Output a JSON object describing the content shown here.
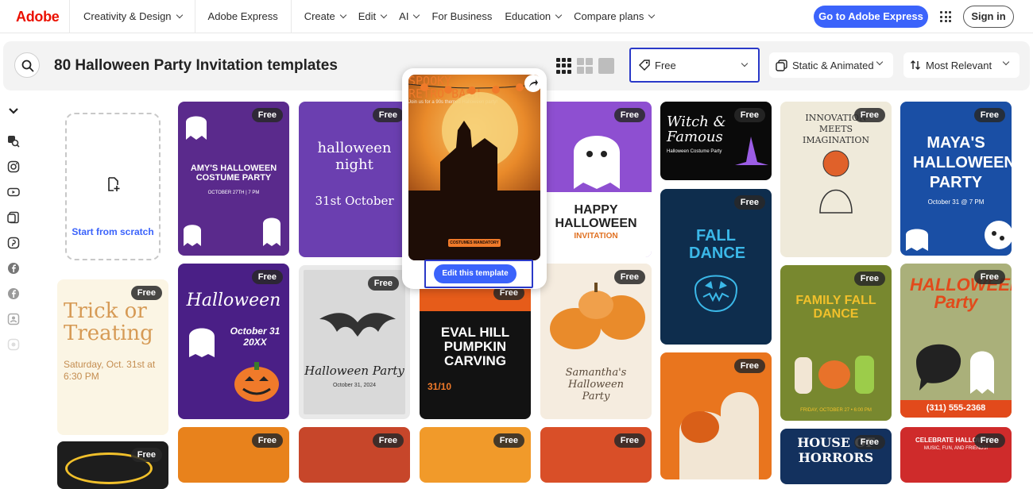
{
  "nav": {
    "logo": "Adobe",
    "items": [
      {
        "label": "Creativity & Design",
        "chevron": true
      },
      {
        "label": "Adobe Express",
        "chevron": false
      },
      {
        "label": "Create",
        "chevron": true
      },
      {
        "label": "Edit",
        "chevron": true
      },
      {
        "label": "AI",
        "chevron": true
      },
      {
        "label": "For Business",
        "chevron": false
      },
      {
        "label": "Education",
        "chevron": true
      },
      {
        "label": "Compare plans",
        "chevron": true
      }
    ],
    "cta": "Go to Adobe Express",
    "signin": "Sign in"
  },
  "toolbar": {
    "title": "80 Halloween Party Invitation templates",
    "filters": {
      "price": "Free",
      "type": "Static & Animated",
      "sort": "Most Relevant"
    }
  },
  "start": {
    "label": "Start from scratch"
  },
  "badge": "Free",
  "hover": {
    "title_1": "SPOOKY",
    "title_2": "RETRO BASH",
    "tagline": "Join us for a 90s themed Halloween party!",
    "chip": "COSTUMES MANDATORY",
    "edit": "Edit this template"
  },
  "cards": [
    {
      "title": "AMY'S HALLOWEEN COSTUME PARTY",
      "sub": "OCTOBER 27TH | 7 PM",
      "bg": "#5a2a8c"
    },
    {
      "title": "halloween night",
      "sub": "31st October",
      "bg": "#6b3fb0"
    },
    {
      "title": "HAPPY HALLOWEEN",
      "sub": "INVITATION",
      "bg": "#8e4fd1"
    },
    {
      "title": "Witch & Famous",
      "sub": "Halloween Costume Party",
      "bg": "#0a0a0a"
    },
    {
      "title": "INNOVATION MEETS IMAGINATION",
      "sub": "",
      "bg": "#efeada"
    },
    {
      "title": "MAYA'S HALLOWEEN PARTY",
      "sub": "October 31 @ 7 PM",
      "bg": "#1a4fa5"
    },
    {
      "title": "Trick or Treating",
      "sub": "Saturday, Oct. 31st at 6:30 PM",
      "bg": "#fbf5e4"
    },
    {
      "title": "Halloween",
      "sub": "October 31 20XX",
      "bg": "#4a1f86"
    },
    {
      "title": "Halloween Party",
      "sub": "October 31, 2024",
      "bg": "#d9d9d9"
    },
    {
      "title": "EVAL HILL PUMPKIN CARVING",
      "sub": "31/10",
      "bg": "#121212"
    },
    {
      "title": "Samantha's Halloween Party",
      "sub": "",
      "bg": "#f5ecdf"
    },
    {
      "title": "FALL DANCE",
      "sub": "",
      "bg": "#0e2d4d"
    },
    {
      "title": "FAMILY FALL DANCE",
      "sub": "FRIDAY, OCTOBER 27 • 6:00 PM",
      "bg": "#78882f"
    },
    {
      "title": "HALLOWEEN Party",
      "sub": "(311) 555-2368",
      "bg": "#aab07a"
    },
    {
      "title": "",
      "sub": "",
      "bg": "#e9751e"
    },
    {
      "title": "HOUSE OF HORRORS",
      "sub": "",
      "bg": "#13315e"
    },
    {
      "title": "CELEBRATE HALLOWEEN",
      "sub": "MUSIC, FUN, AND FRIENDS!",
      "bg": "#cf2b2b"
    }
  ]
}
